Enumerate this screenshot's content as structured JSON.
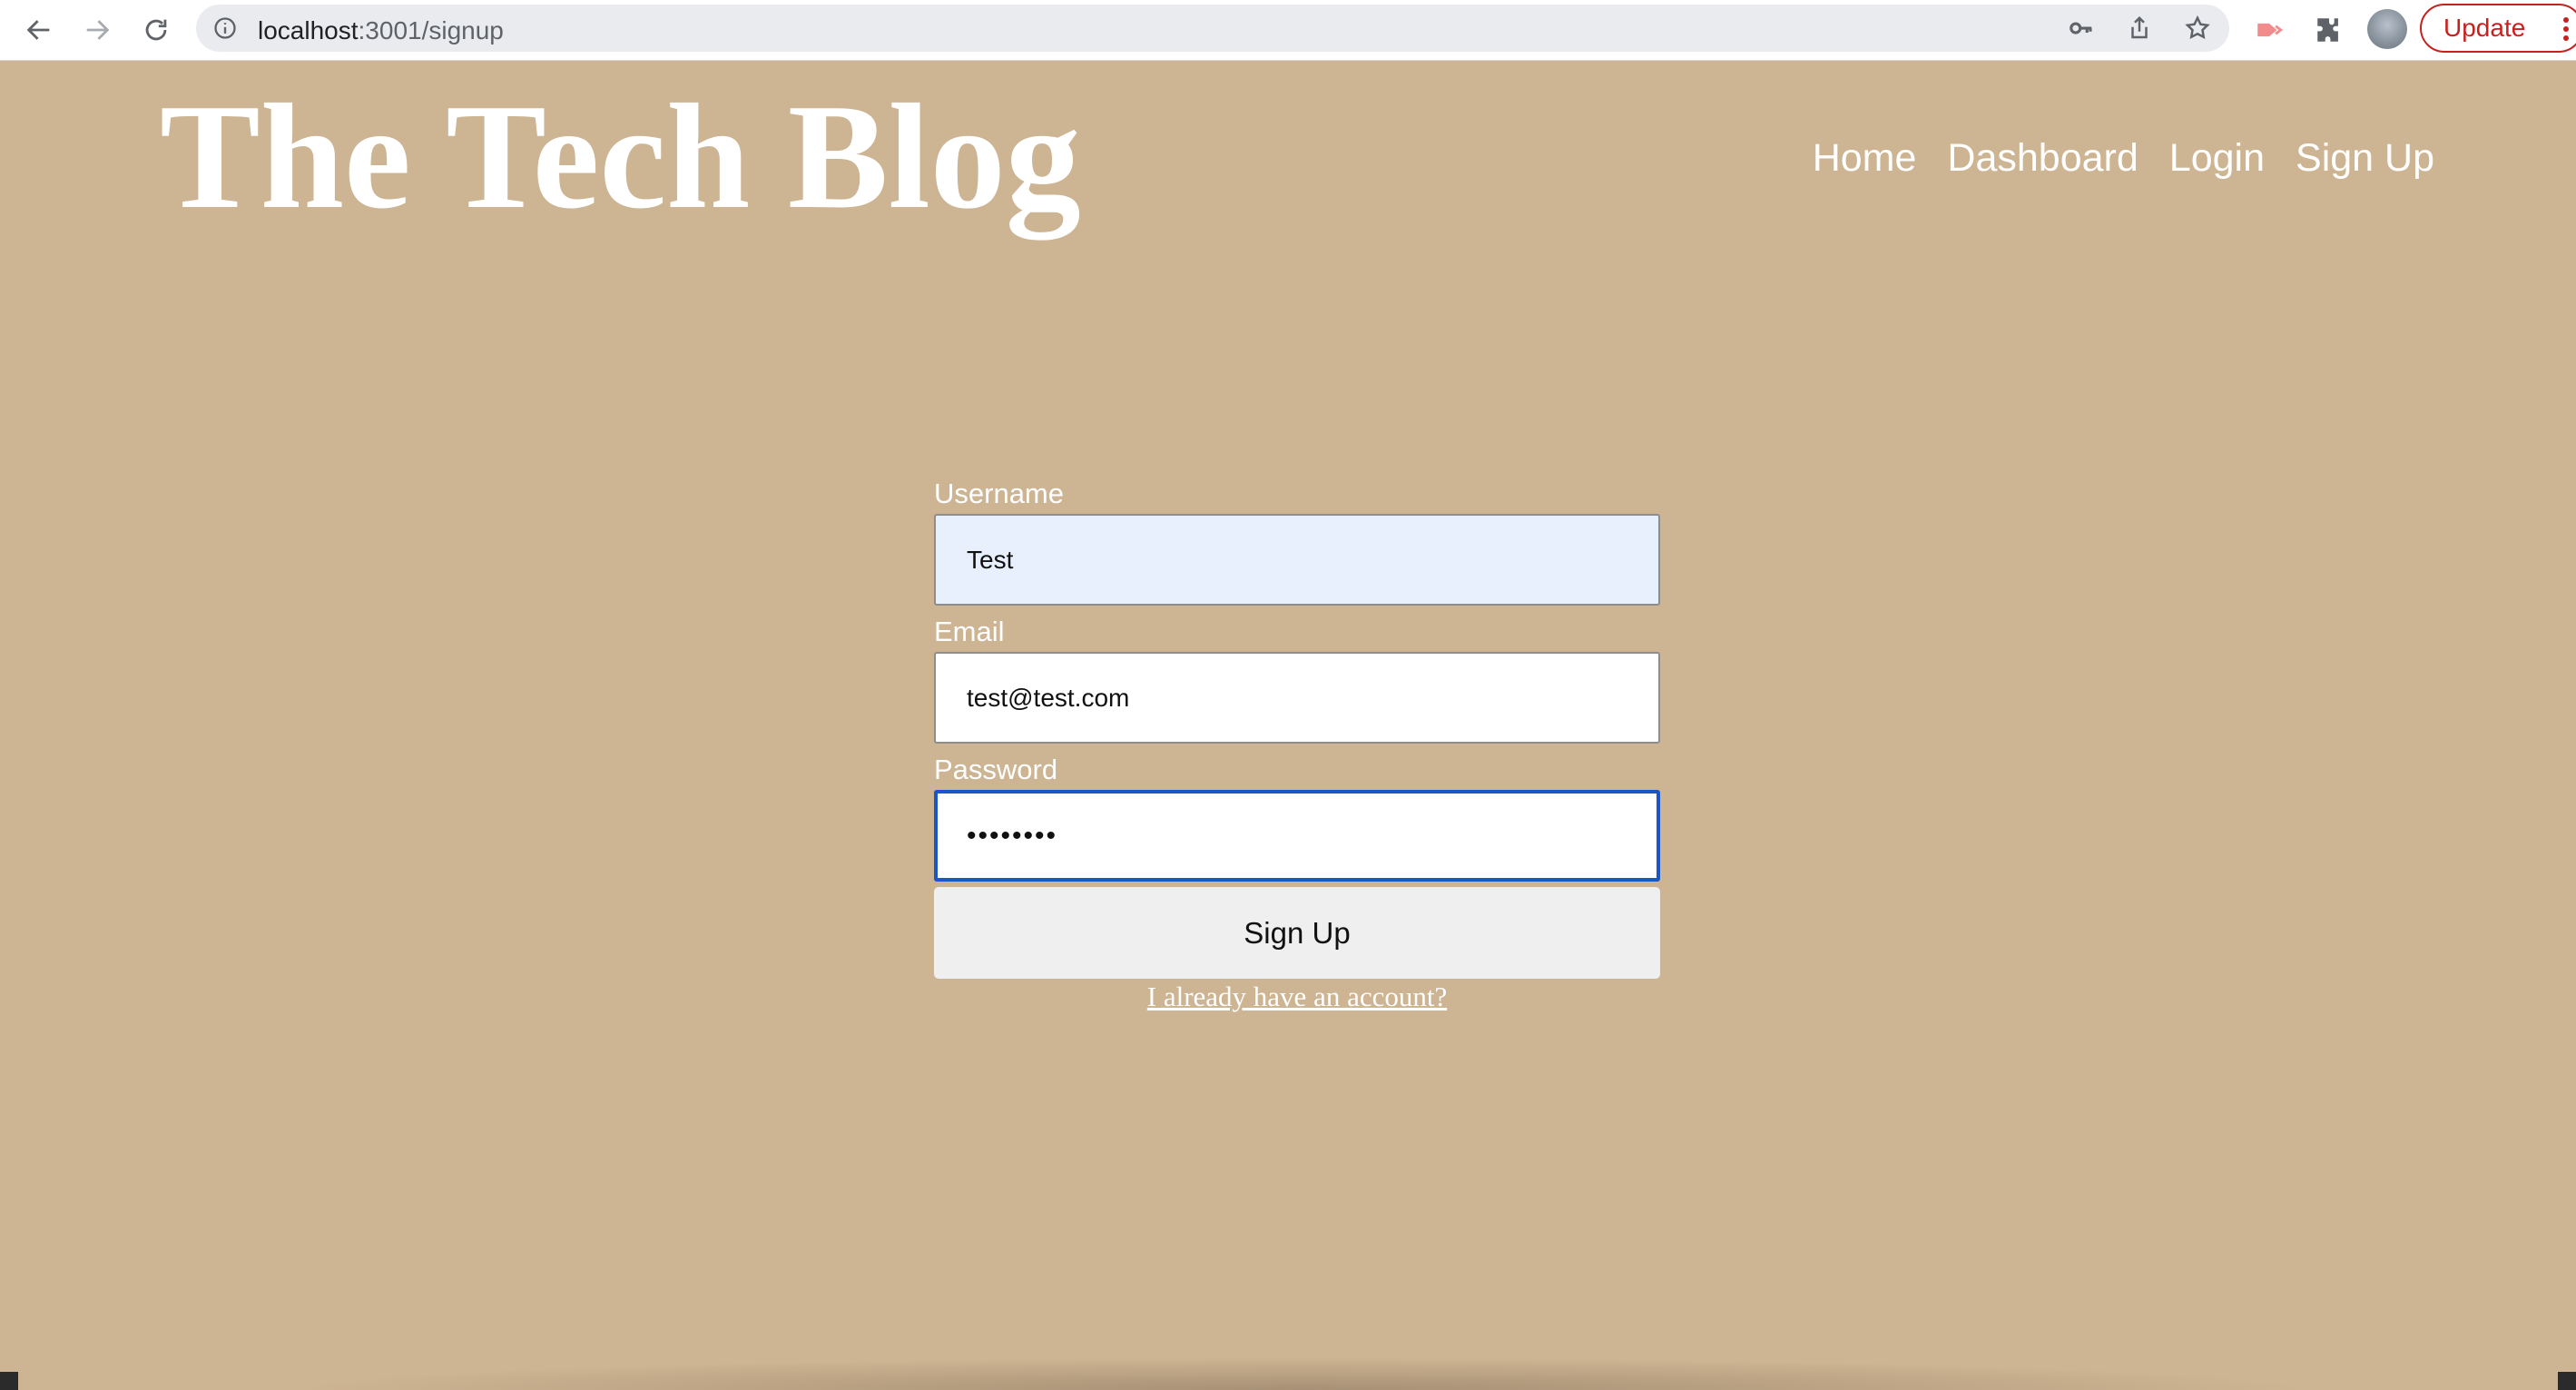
{
  "browser": {
    "url_host": "localhost",
    "url_path": ":3001/signup",
    "update_label": "Update"
  },
  "site": {
    "title": "The Tech Blog",
    "nav": [
      "Home",
      "Dashboard",
      "Login",
      "Sign Up"
    ]
  },
  "form": {
    "username_label": "Username",
    "username_value": "Test",
    "email_label": "Email",
    "email_value": "test@test.com",
    "password_label": "Password",
    "password_value": "••••••••",
    "submit_label": "Sign Up",
    "login_link": "I already have an account?"
  },
  "colors": {
    "page_bg": "#cdb492",
    "focus_ring": "#1a56c6",
    "autofill_bg": "#e8f0fe",
    "update_red": "#c5221f"
  }
}
